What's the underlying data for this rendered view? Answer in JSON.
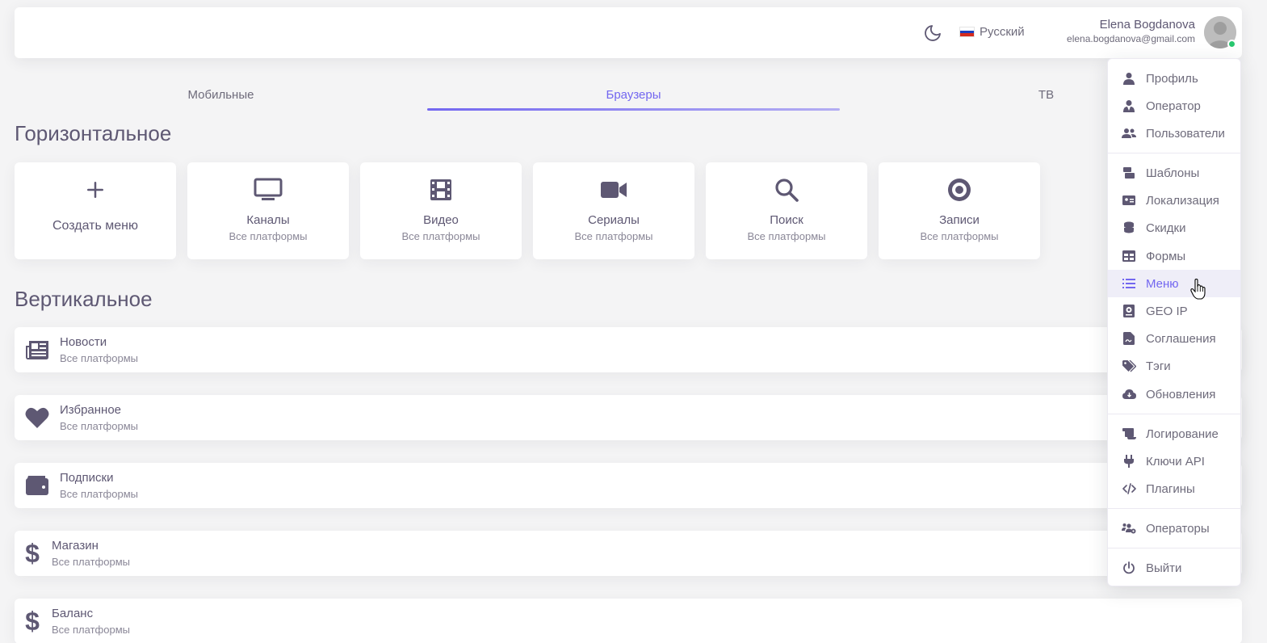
{
  "header": {
    "theme_icon": "moon-icon",
    "language": "Русский",
    "user_name": "Elena Bogdanova",
    "user_email": "elena.bogdanova@gmail.com"
  },
  "tabs": [
    {
      "label": "Мобильные",
      "active": false
    },
    {
      "label": "Браузеры",
      "active": true
    },
    {
      "label": "ТВ",
      "active": false
    }
  ],
  "horizontal": {
    "title": "Горизонтальное",
    "create_label": "Создать меню",
    "items": [
      {
        "title": "Каналы",
        "sub": "Все платформы",
        "icon": "monitor-icon"
      },
      {
        "title": "Видео",
        "sub": "Все платформы",
        "icon": "film-icon"
      },
      {
        "title": "Сериалы",
        "sub": "Все платформы",
        "icon": "video-camera-icon"
      },
      {
        "title": "Поиск",
        "sub": "Все платформы",
        "icon": "search-icon"
      },
      {
        "title": "Записи",
        "sub": "Все платформы",
        "icon": "record-icon"
      }
    ]
  },
  "vertical": {
    "title": "Вертикальное",
    "items": [
      {
        "title": "Новости",
        "sub": "Все платформы",
        "icon": "newspaper-icon"
      },
      {
        "title": "Избранное",
        "sub": "Все платформы",
        "icon": "heart-icon"
      },
      {
        "title": "Подписки",
        "sub": "Все платформы",
        "icon": "wallet-icon"
      },
      {
        "title": "Магазин",
        "sub": "Все платформы",
        "icon": "dollar-icon"
      },
      {
        "title": "Баланс",
        "sub": "Все платформы",
        "icon": "dollar-icon"
      }
    ]
  },
  "dropdown": {
    "items": [
      {
        "label": "Профиль",
        "icon": "user-icon"
      },
      {
        "label": "Оператор",
        "icon": "user-tie-icon"
      },
      {
        "label": "Пользователи",
        "icon": "users-icon"
      },
      {
        "label": "Шаблоны",
        "icon": "templates-icon"
      },
      {
        "label": "Локализация",
        "icon": "id-card-icon"
      },
      {
        "label": "Скидки",
        "icon": "coins-icon"
      },
      {
        "label": "Формы",
        "icon": "table-icon"
      },
      {
        "label": "Меню",
        "icon": "list-icon",
        "active": true
      },
      {
        "label": "GEO IP",
        "icon": "passport-icon"
      },
      {
        "label": "Соглашения",
        "icon": "file-signature-icon"
      },
      {
        "label": "Тэги",
        "icon": "tags-icon"
      },
      {
        "label": "Обновления",
        "icon": "cloud-download-icon"
      },
      {
        "label": "Логирование",
        "icon": "scroll-icon"
      },
      {
        "label": "Ключи API",
        "icon": "plug-icon"
      },
      {
        "label": "Плагины",
        "icon": "code-icon"
      },
      {
        "label": "Операторы",
        "icon": "users-cog-icon"
      },
      {
        "label": "Выйти",
        "icon": "power-icon"
      }
    ]
  },
  "colors": {
    "accent": "#7367f0",
    "online": "#28c76f",
    "text": "#5e5873",
    "muted": "#8a8797"
  }
}
